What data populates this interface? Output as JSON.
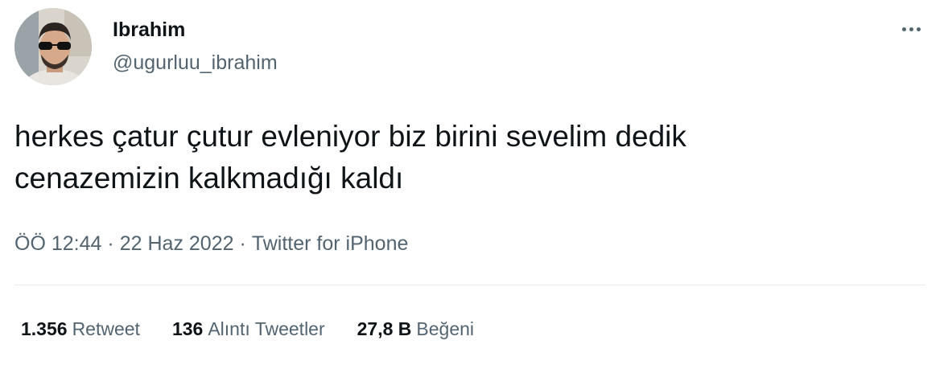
{
  "author": {
    "name": "Ibrahim",
    "handle": "@ugurluu_ibrahim",
    "avatar_icon": "user-avatar-photo"
  },
  "more_icon": "more-options-icon",
  "tweet": {
    "lines": [
      "herkes çatur çutur evleniyor biz birini sevelim dedik",
      "cenazemizin kalkmadığı kaldı"
    ]
  },
  "meta": {
    "time": "ÖÖ 12:44",
    "separator": "·",
    "date": "22 Haz 2022",
    "source": "Twitter for iPhone"
  },
  "stats": {
    "retweets": {
      "value": "1.356",
      "label": "Retweet"
    },
    "quotes": {
      "value": "136",
      "label": "Alıntı Tweetler"
    },
    "likes": {
      "value": "27,8 B",
      "label": "Beğeni"
    }
  },
  "colors": {
    "text_primary": "#0f1419",
    "text_secondary": "#536471",
    "divider": "#e6ecf0"
  }
}
